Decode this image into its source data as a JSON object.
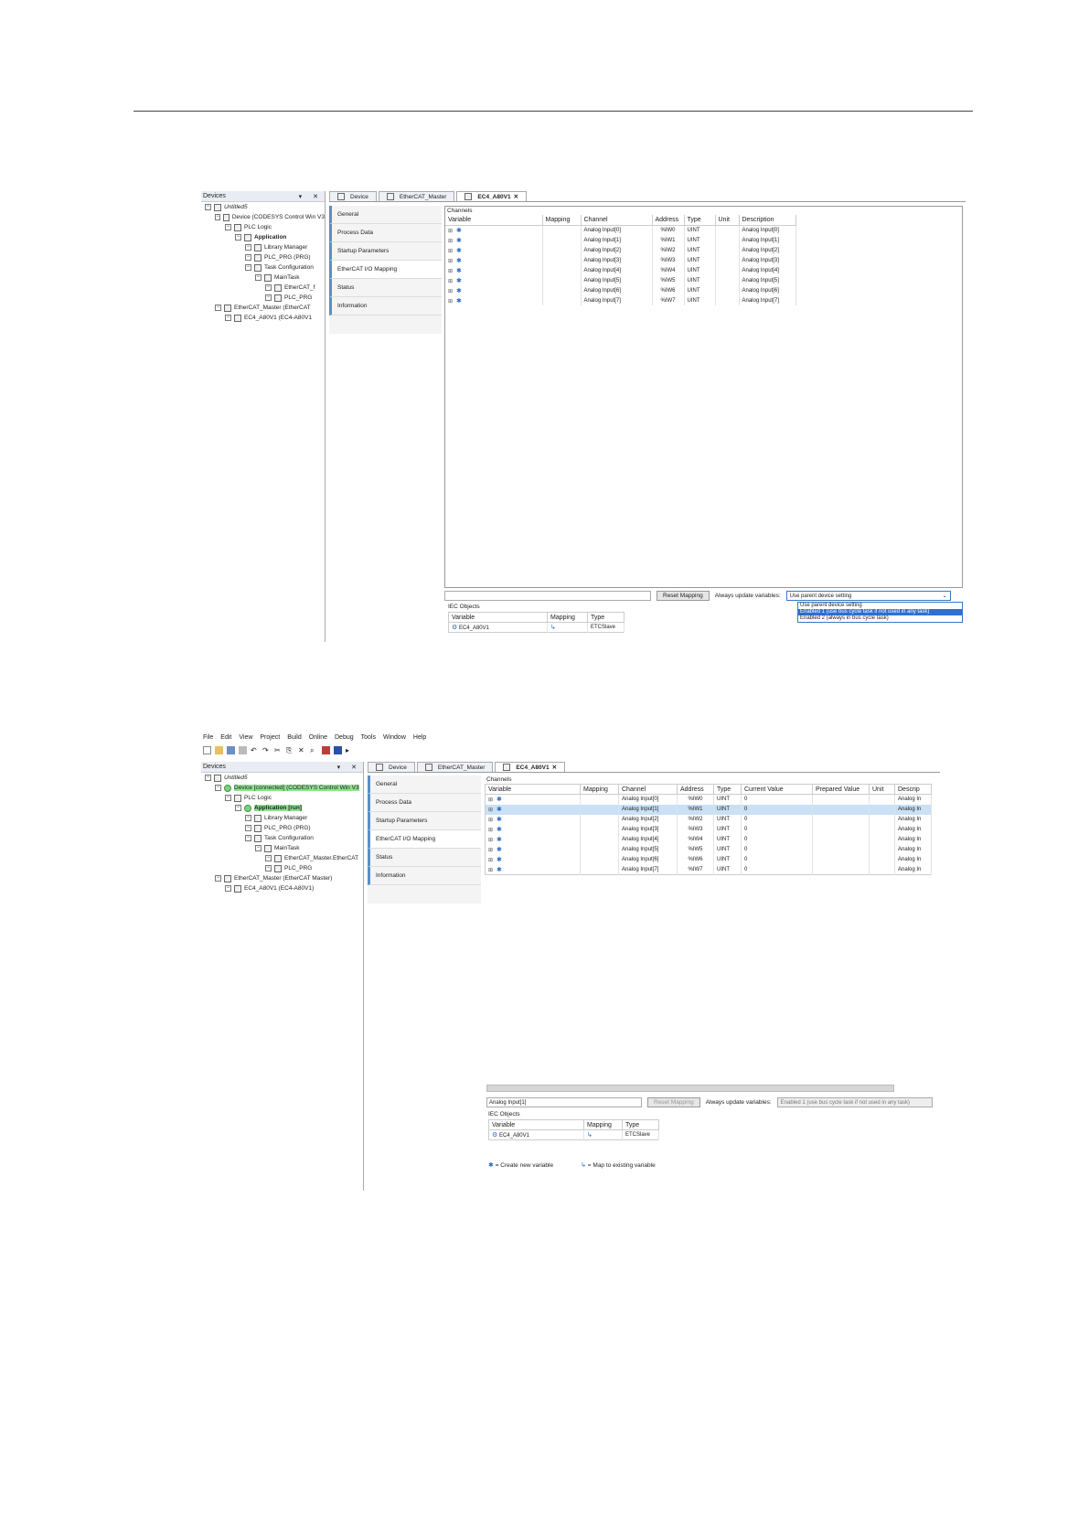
{
  "shot1": {
    "devices": {
      "title": "Devices",
      "controls": "▾ ✕",
      "tree": [
        {
          "label": "Untitled5",
          "indent": 0,
          "style": "ital"
        },
        {
          "label": "Device (CODESYS Control Win V3",
          "indent": 1
        },
        {
          "label": "PLC Logic",
          "indent": 2
        },
        {
          "label": "Application",
          "indent": 3,
          "style": "bold"
        },
        {
          "label": "Library Manager",
          "indent": 4
        },
        {
          "label": "PLC_PRG (PRG)",
          "indent": 4
        },
        {
          "label": "Task Configuration",
          "indent": 4
        },
        {
          "label": "MainTask",
          "indent": 5
        },
        {
          "label": "EtherCAT_f",
          "indent": 6
        },
        {
          "label": "PLC_PRG",
          "indent": 6
        },
        {
          "label": "EtherCAT_Master (EtherCAT",
          "indent": 1
        },
        {
          "label": "EC4_A80V1 (EC4-A80V1",
          "indent": 2
        }
      ]
    },
    "tabs": [
      "Device",
      "EtherCAT_Master",
      "EC4_A80V1"
    ],
    "pages": [
      "General",
      "Process Data",
      "Startup Parameters",
      "EtherCAT I/O Mapping",
      "Status",
      "Information"
    ],
    "active_page": "EtherCAT I/O Mapping",
    "channels_label": "Channels",
    "columns": [
      "Variable",
      "Mapping",
      "Channel",
      "Address",
      "Type",
      "Unit",
      "Description"
    ],
    "rows": [
      {
        "channel": "Analog Input[0]",
        "address": "%IW0",
        "type": "UINT",
        "description": "Analog Input[0]"
      },
      {
        "channel": "Analog Input[1]",
        "address": "%IW1",
        "type": "UINT",
        "description": "Analog Input[1]"
      },
      {
        "channel": "Analog Input[2]",
        "address": "%IW2",
        "type": "UINT",
        "description": "Analog Input[2]"
      },
      {
        "channel": "Analog Input[3]",
        "address": "%IW3",
        "type": "UINT",
        "description": "Analog Input[3]"
      },
      {
        "channel": "Analog Input[4]",
        "address": "%IW4",
        "type": "UINT",
        "description": "Analog Input[4]"
      },
      {
        "channel": "Analog Input[5]",
        "address": "%IW5",
        "type": "UINT",
        "description": "Analog Input[5]"
      },
      {
        "channel": "Analog Input[6]",
        "address": "%IW6",
        "type": "UINT",
        "description": "Analog Input[6]"
      },
      {
        "channel": "Analog Input[7]",
        "address": "%IW7",
        "type": "UINT",
        "description": "Analog Input[7]"
      }
    ],
    "reset_mapping": "Reset Mapping",
    "always_update_label": "Always update variables:",
    "always_update_value": "Use parent device setting",
    "dropdown_options": [
      "Use parent device setting",
      "Enabled 1 (use bus cycle task if not used in any task)",
      "Enabled 2 (always in bus cycle task)"
    ],
    "iec_label": "IEC Objects",
    "iec_columns": [
      "Variable",
      "Mapping",
      "Type"
    ],
    "iec_row": {
      "variable": "EC4_A80V1",
      "type": "ETCSlave"
    }
  },
  "shot2": {
    "menu": [
      "File",
      "Edit",
      "View",
      "Project",
      "Build",
      "Online",
      "Debug",
      "Tools",
      "Window",
      "Help"
    ],
    "devices": {
      "title": "Devices",
      "controls": "▾ ✕",
      "tree": [
        {
          "label": "Untitled5",
          "indent": 0,
          "style": "ital"
        },
        {
          "label": "Device [connected] (CODESYS Control Win V3",
          "indent": 1,
          "style": "hl"
        },
        {
          "label": "PLC Logic",
          "indent": 2
        },
        {
          "label": "Application [run]",
          "indent": 3,
          "style": "bold hl"
        },
        {
          "label": "Library Manager",
          "indent": 4
        },
        {
          "label": "PLC_PRG (PRG)",
          "indent": 4
        },
        {
          "label": "Task Configuration",
          "indent": 4
        },
        {
          "label": "MainTask",
          "indent": 5
        },
        {
          "label": "EtherCAT_Master.EtherCAT",
          "indent": 6
        },
        {
          "label": "PLC_PRG",
          "indent": 6
        },
        {
          "label": "EtherCAT_Master (EtherCAT Master)",
          "indent": 1
        },
        {
          "label": "EC4_A80V1 (EC4-A80V1)",
          "indent": 2
        }
      ]
    },
    "tabs": [
      "Device",
      "EtherCAT_Master",
      "EC4_A80V1"
    ],
    "pages": [
      "General",
      "Process Data",
      "Startup Parameters",
      "EtherCAT I/O Mapping",
      "Status",
      "Information"
    ],
    "channels_label": "Channels",
    "columns": [
      "Variable",
      "Mapping",
      "Channel",
      "Address",
      "Type",
      "Current Value",
      "Prepared Value",
      "Unit",
      "Descrip"
    ],
    "rows": [
      {
        "channel": "Analog Input[0]",
        "address": "%IW0",
        "type": "UINT",
        "current": "0",
        "description": "Analog In"
      },
      {
        "channel": "Analog Input[1]",
        "address": "%IW1",
        "type": "UINT",
        "current": "0",
        "description": "Analog In"
      },
      {
        "channel": "Analog Input[2]",
        "address": "%IW2",
        "type": "UINT",
        "current": "0",
        "description": "Analog In"
      },
      {
        "channel": "Analog Input[3]",
        "address": "%IW3",
        "type": "UINT",
        "current": "0",
        "description": "Analog In"
      },
      {
        "channel": "Analog Input[4]",
        "address": "%IW4",
        "type": "UINT",
        "current": "0",
        "description": "Analog In"
      },
      {
        "channel": "Analog Input[5]",
        "address": "%IW5",
        "type": "UINT",
        "current": "0",
        "description": "Analog In"
      },
      {
        "channel": "Analog Input[6]",
        "address": "%IW6",
        "type": "UINT",
        "current": "0",
        "description": "Analog In"
      },
      {
        "channel": "Analog Input[7]",
        "address": "%IW7",
        "type": "UINT",
        "current": "0",
        "description": "Analog In"
      }
    ],
    "selected_row": 1,
    "selected_var": "Analog Input[1]",
    "reset_mapping": "Reset Mapping",
    "always_update_label": "Always update variables:",
    "always_update_value": "Enabled 1 (use bus cycle task if not used in any task)",
    "iec_label": "IEC Objects",
    "iec_columns": [
      "Variable",
      "Mapping",
      "Type"
    ],
    "iec_row": {
      "variable": "EC4_A80V1",
      "type": "ETCSlave"
    },
    "legend_create": "= Create new variable",
    "legend_map": "= Map to existing variable"
  }
}
